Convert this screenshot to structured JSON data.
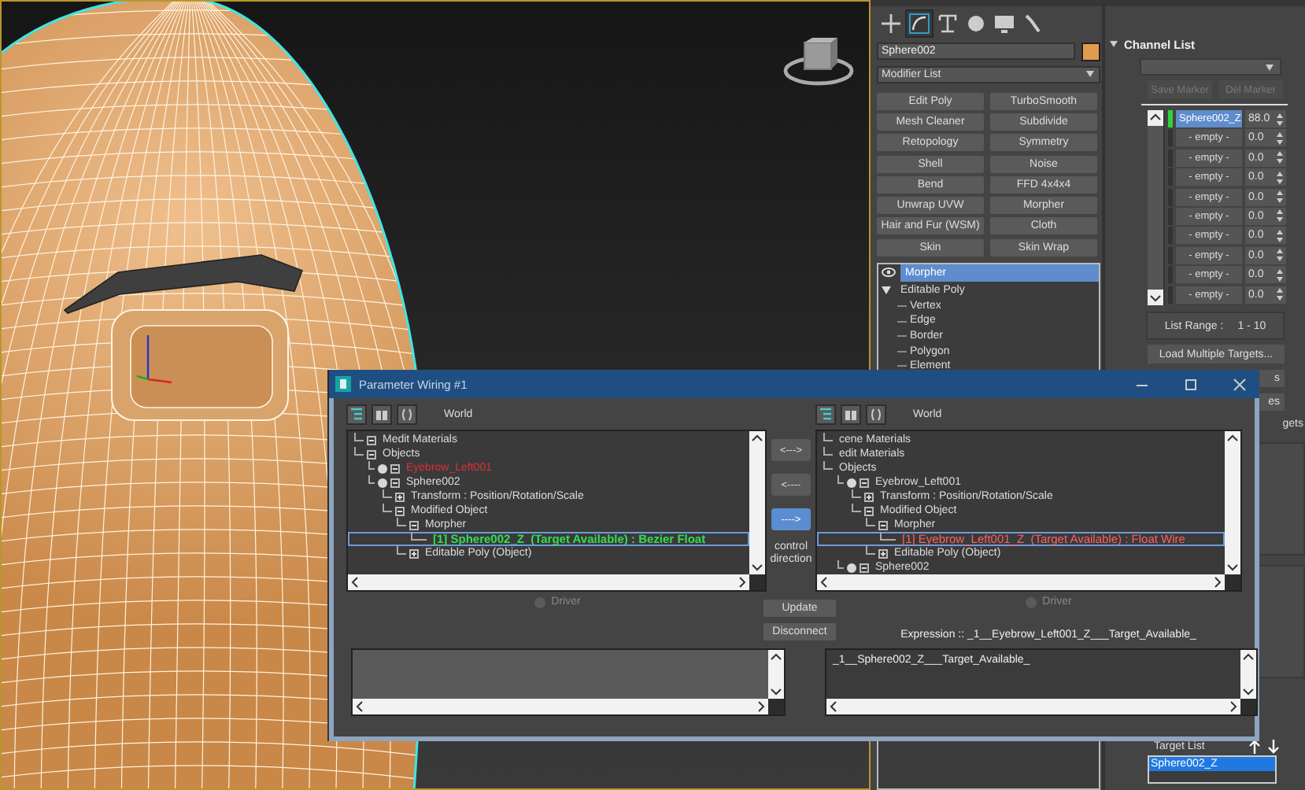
{
  "command_panel": {
    "tabs": [
      {
        "selected": false
      },
      {
        "selected": true
      },
      {
        "selected": false
      },
      {
        "selected": false
      },
      {
        "selected": false
      },
      {
        "selected": false
      }
    ],
    "object_name": "Sphere002",
    "modifier_list": "Modifier List",
    "modifier_buttons": [
      "Edit Poly",
      "TurboSmooth",
      "Mesh Cleaner",
      "Subdivide",
      "Retopology",
      "Symmetry",
      "Shell",
      "Noise",
      "Bend",
      "FFD 4x4x4",
      "Unwrap UVW",
      "Morpher",
      "Hair and Fur (WSM)",
      "Cloth",
      "Skin",
      "Skin Wrap"
    ],
    "stack": [
      {
        "label": "Morpher",
        "kind": "modifier",
        "selected": true
      },
      {
        "label": "Editable Poly",
        "kind": "object",
        "selected": false,
        "expanded": true,
        "children": [
          {
            "label": "Vertex"
          },
          {
            "label": "Edge"
          },
          {
            "label": "Border"
          },
          {
            "label": "Polygon"
          },
          {
            "label": "Element"
          }
        ]
      }
    ]
  },
  "channel_list": {
    "title": "Channel List",
    "save_marker": "Save Marker",
    "del_marker": "Del Marker",
    "markers_disabled": true,
    "channels": [
      {
        "name": "Sphere002_Z",
        "value": "88.0",
        "selected": true,
        "active": true
      },
      {
        "name": "- empty -",
        "value": "0.0",
        "selected": false,
        "active": false
      },
      {
        "name": "- empty -",
        "value": "0.0",
        "selected": false,
        "active": false
      },
      {
        "name": "- empty -",
        "value": "0.0",
        "selected": false,
        "active": false
      },
      {
        "name": "- empty -",
        "value": "0.0",
        "selected": false,
        "active": false
      },
      {
        "name": "- empty -",
        "value": "0.0",
        "selected": false,
        "active": false
      },
      {
        "name": "- empty -",
        "value": "0.0",
        "selected": false,
        "active": false
      },
      {
        "name": "- empty -",
        "value": "0.0",
        "selected": false,
        "active": false
      },
      {
        "name": "- empty -",
        "value": "0.0",
        "selected": false,
        "active": false
      },
      {
        "name": "- empty -",
        "value": "0.0",
        "selected": false,
        "active": false
      }
    ],
    "list_range_label": "List Range :",
    "list_range": "1 - 10",
    "load_button": "Load Multiple Targets...",
    "partly_hidden_buttons": [
      "s",
      "es"
    ],
    "partly_hidden_label": "gets",
    "target_list": {
      "title": "Target List",
      "items": [
        {
          "label": "Sphere002_Z",
          "selected": true
        }
      ]
    }
  },
  "dialog": {
    "title": "Parameter Wiring #1",
    "left": {
      "label": "World",
      "driver": "Driver",
      "tree": [
        {
          "label": "Medit Materials",
          "kind": "folder",
          "expanded": true,
          "selected": false
        },
        {
          "label": "Objects",
          "kind": "folder",
          "expanded": true,
          "selected": false,
          "children": [
            {
              "label": "Eyebrow_Left001",
              "kind": "object",
              "color": "#e03030",
              "expanded": true,
              "selected": false
            },
            {
              "label": "Sphere002",
              "kind": "object",
              "expanded": true,
              "selected": false,
              "children": [
                {
                  "label": "Transform : Position/Rotation/Scale",
                  "kind": "folder",
                  "expanded": false,
                  "selected": false
                },
                {
                  "label": "Modified Object",
                  "kind": "folder",
                  "expanded": true,
                  "selected": false,
                  "children": [
                    {
                      "label": "Morpher",
                      "kind": "folder",
                      "expanded": true,
                      "selected": false,
                      "children": [
                        {
                          "label": "[1] Sphere002_Z  (Target Available) : Bezier Float",
                          "kind": "track",
                          "color": "#33dd55",
                          "bold": true,
                          "selected": true
                        }
                      ]
                    },
                    {
                      "label": "Editable Poly (Object)",
                      "kind": "folder",
                      "expanded": false,
                      "selected": false
                    }
                  ]
                }
              ]
            }
          ]
        }
      ]
    },
    "right": {
      "label": "World",
      "driver": "Driver",
      "tree": [
        {
          "label": "cene Materials",
          "kind": "folder",
          "selected": false
        },
        {
          "label": "edit Materials",
          "kind": "folder",
          "selected": false
        },
        {
          "label": "Objects",
          "kind": "folder",
          "selected": false,
          "children": [
            {
              "label": "Eyebrow_Left001",
              "kind": "object",
              "expanded": true,
              "selected": false,
              "children": [
                {
                  "label": "Transform : Position/Rotation/Scale",
                  "kind": "folder",
                  "expanded": false,
                  "selected": false
                },
                {
                  "label": "Modified Object",
                  "kind": "folder",
                  "expanded": true,
                  "selected": false,
                  "children": [
                    {
                      "label": "Morpher",
                      "kind": "folder",
                      "expanded": true,
                      "selected": false,
                      "children": [
                        {
                          "label": "[1] Eyebrow_Left001_Z  (Target Available) : Float Wire",
                          "kind": "track",
                          "color": "#ff6060",
                          "selected": true
                        }
                      ]
                    },
                    {
                      "label": "Editable Poly (Object)",
                      "kind": "folder",
                      "expanded": false,
                      "selected": false
                    }
                  ]
                }
              ]
            },
            {
              "label": "Sphere002",
              "kind": "object",
              "expanded": true,
              "selected": false
            }
          ]
        }
      ],
      "expression": "_1__Sphere002_Z___Target_Available_"
    },
    "direction_buttons": [
      {
        "label": "<--->",
        "selected": false
      },
      {
        "label": "<----",
        "selected": false
      },
      {
        "label": "---->",
        "selected": true
      }
    ],
    "direction_caption": "control direction",
    "update": "Update",
    "disconnect": "Disconnect",
    "expression_label": "Expression :: _1__Eyebrow_Left001_Z___Target_Available_"
  }
}
